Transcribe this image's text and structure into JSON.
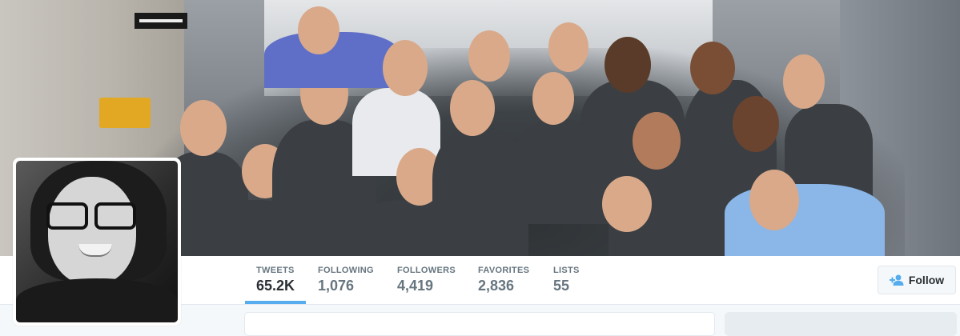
{
  "profile_nav": {
    "stats": [
      {
        "label": "TWEETS",
        "value": "65.2K",
        "active": true
      },
      {
        "label": "FOLLOWING",
        "value": "1,076",
        "active": false
      },
      {
        "label": "FOLLOWERS",
        "value": "4,419",
        "active": false
      },
      {
        "label": "FAVORITES",
        "value": "2,836",
        "active": false
      },
      {
        "label": "LISTS",
        "value": "55",
        "active": false
      }
    ],
    "follow_label": "Follow"
  },
  "colors": {
    "accent": "#55acee",
    "text_primary": "#292f33",
    "text_secondary": "#66757f"
  },
  "icons": {
    "follow": "add-user-icon"
  }
}
